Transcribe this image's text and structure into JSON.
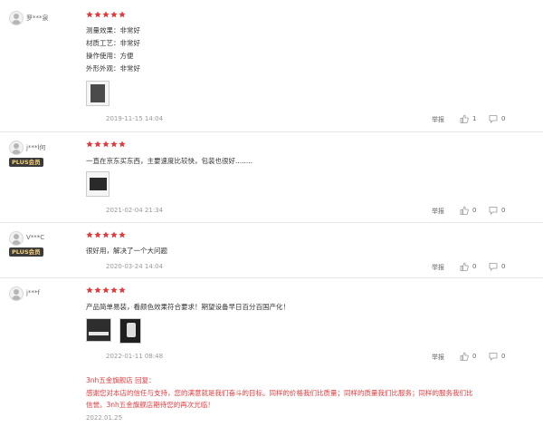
{
  "star_color": "#e4393c",
  "reply_color": "#e4393c",
  "reviews": [
    {
      "user": "罗***泉",
      "plus": "",
      "rating": 5,
      "lines": [
        "测量效果：非常好",
        "材质工艺：非常好",
        "操作使用：方便",
        "外形外观：非常好"
      ],
      "date": "2019-11-15 14:04",
      "report": "举报",
      "likes": "1",
      "comments": "0"
    },
    {
      "user": "j***l何",
      "plus": "PLUS会员",
      "rating": 5,
      "lines": [
        "一直在京东买东西，主要速度比较快，包装也很好........"
      ],
      "date": "2021-02-04 21:34",
      "report": "举报",
      "likes": "0",
      "comments": "0"
    },
    {
      "user": "V***C",
      "plus": "PLUS会员",
      "rating": 5,
      "lines": [
        "很好用，解决了一个大问题"
      ],
      "date": "2020-03-24 14:04",
      "report": "举报",
      "likes": "0",
      "comments": "0"
    },
    {
      "user": "j***f",
      "plus": "",
      "rating": 5,
      "lines": [
        "产品简单易装，看颜色效果符合要求！期望设备早日百分百国产化！"
      ],
      "date": "2022-01-11 08:48",
      "report": "举报",
      "likes": "0",
      "comments": "0",
      "reply": {
        "header": "3nh五金旗舰店 回复：",
        "lines": [
          "感谢您对本店的信任与支持，您的满意就是我们奋斗的目标。同样的价格我们比质量；同样的质量我们比服务；同样的服务我们比",
          "信誉。3nh五金旗舰店期待您的再次光临！"
        ],
        "date": "2022.01.25"
      }
    }
  ]
}
